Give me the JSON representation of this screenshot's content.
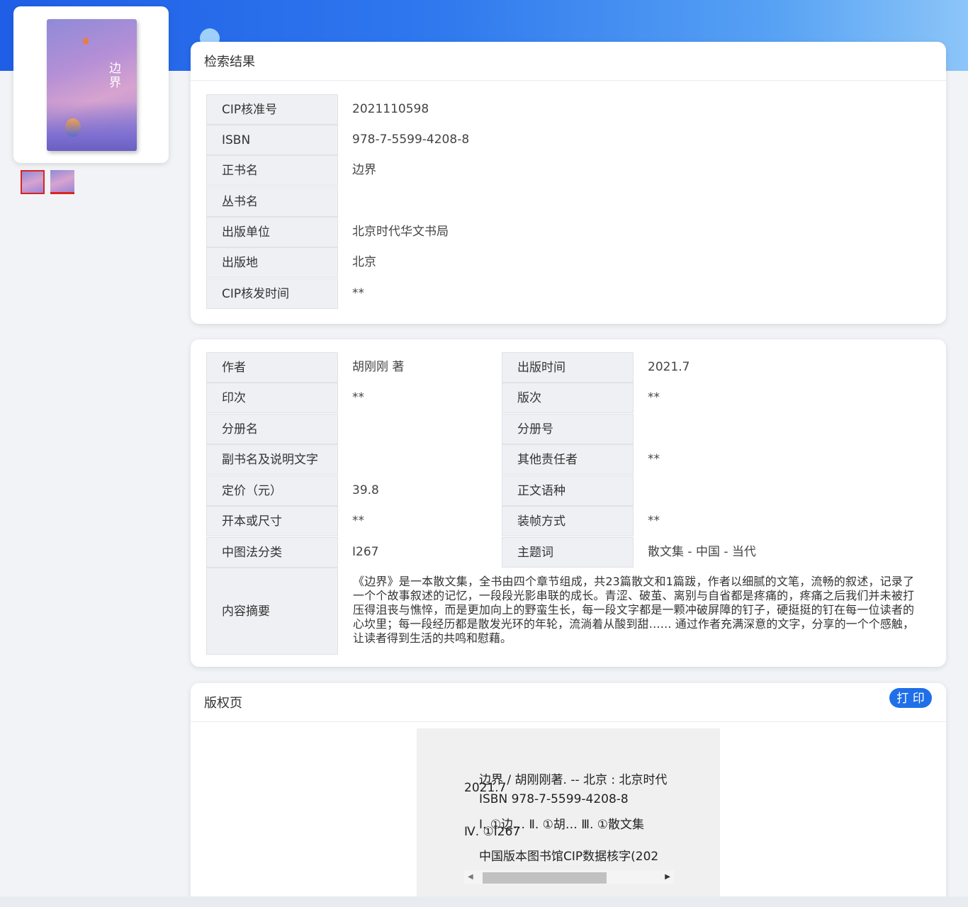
{
  "cover": {
    "title_text": "边界"
  },
  "search_result": {
    "header": "检索结果",
    "rows": [
      {
        "label": "CIP核准号",
        "value": "2021110598"
      },
      {
        "label": "ISBN",
        "value": "978-7-5599-4208-8"
      },
      {
        "label": "正书名",
        "value": "边界"
      },
      {
        "label": "丛书名",
        "value": ""
      },
      {
        "label": "出版单位",
        "value": "北京时代华文书局"
      },
      {
        "label": "出版地",
        "value": "北京"
      },
      {
        "label": "CIP核发时间",
        "value": "**"
      }
    ]
  },
  "details": {
    "left": [
      {
        "label": "作者",
        "value": "胡刚刚 著"
      },
      {
        "label": "印次",
        "value": "**"
      },
      {
        "label": "分册名",
        "value": ""
      },
      {
        "label": "副书名及说明文字",
        "value": ""
      },
      {
        "label": "定价（元）",
        "value": "39.8"
      },
      {
        "label": "开本或尺寸",
        "value": "**"
      },
      {
        "label": "中图法分类",
        "value": "I267"
      }
    ],
    "right": [
      {
        "label": "出版时间",
        "value": "2021.7"
      },
      {
        "label": "版次",
        "value": "**"
      },
      {
        "label": "分册号",
        "value": ""
      },
      {
        "label": "其他责任者",
        "value": "**"
      },
      {
        "label": "正文语种",
        "value": ""
      },
      {
        "label": "装帧方式",
        "value": "**"
      },
      {
        "label": "主题词",
        "value": "散文集 - 中国 - 当代"
      }
    ],
    "summary_label": "内容摘要",
    "summary": "《边界》是一本散文集，全书由四个章节组成，共23篇散文和1篇跋，作者以细腻的文笔，流畅的叙述，记录了一个个故事叙述的记忆，一段段光影串联的成长。青涩、破茧、离别与自省都是疼痛的，疼痛之后我们并未被打压得沮丧与憔悴，而是更加向上的野蛮生长，每一段文字都是一颗冲破屏障的钉子，硬挺挺的钉在每一位读者的心坎里；每一段经历都是散发光环的年轮，流淌着从酸到甜…… 通过作者充满深意的文字，分享的一个个感触，让读者得到生活的共鸣和慰藉。"
  },
  "copyright": {
    "header": "版权页",
    "print_label": "打 印",
    "lines": {
      "line1": "边界 / 胡刚刚著. -- 北京 : 北京时代",
      "line1b": "2021.7",
      "line2": "ISBN 978-7-5599-4208-8",
      "line3": "Ⅰ. ①边… Ⅱ. ①胡… Ⅲ. ①散文集",
      "line3b": "Ⅳ. ①I267",
      "line4": "中国版本图书馆CIP数据核字(202"
    }
  },
  "scrollbar": {
    "left_arrow": "◀",
    "right_arrow": "▶"
  }
}
